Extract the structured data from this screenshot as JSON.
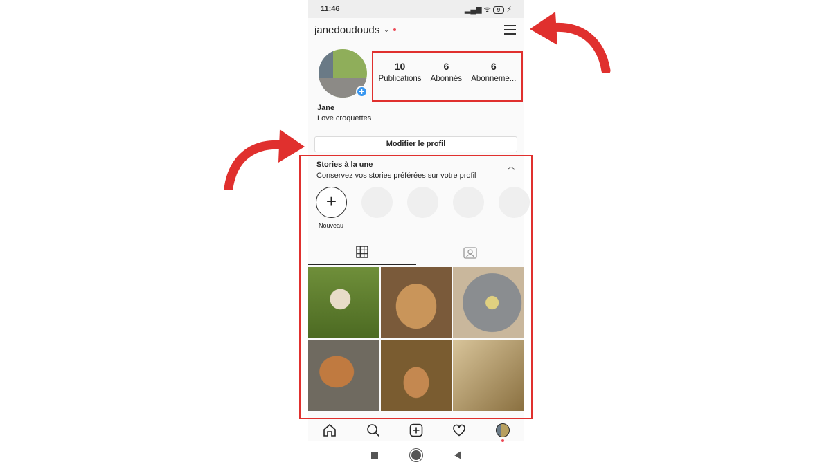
{
  "status_bar": {
    "time": "11:46",
    "battery": "9"
  },
  "header": {
    "username": "janedoudouds"
  },
  "stats": [
    {
      "value": "10",
      "label": "Publications"
    },
    {
      "value": "6",
      "label": "Abonnés"
    },
    {
      "value": "6",
      "label": "Abonneme..."
    }
  ],
  "bio": {
    "name": "Jane",
    "text": "Love croquettes"
  },
  "edit_profile_label": "Modifier le profil",
  "highlights": {
    "title": "Stories à la une",
    "subtitle": "Conservez vos stories préférées sur votre profil",
    "new_label": "Nouveau"
  },
  "colors": {
    "accent": "#3897f0",
    "annotation": "#e0302e",
    "notification": "#ed4956"
  }
}
